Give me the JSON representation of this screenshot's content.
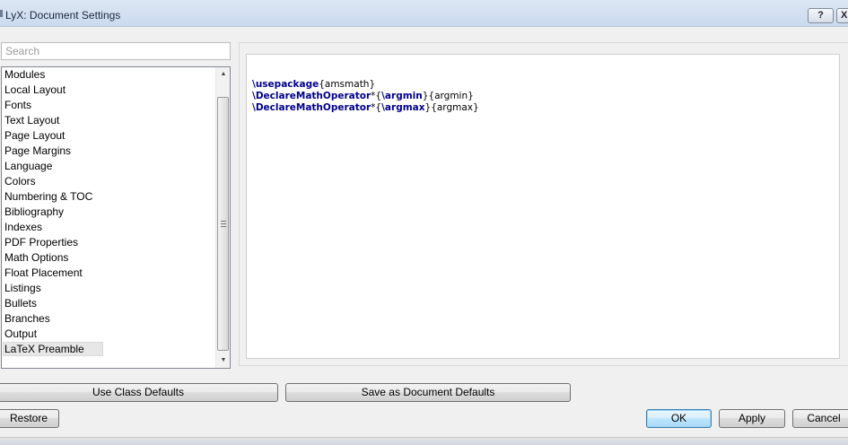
{
  "window": {
    "title": "LyX: Document Settings",
    "help_label": "?",
    "close_label": "X"
  },
  "search": {
    "placeholder": "Search",
    "value": ""
  },
  "categories": {
    "items": [
      "Modules",
      "Local Layout",
      "Fonts",
      "Text Layout",
      "Page Layout",
      "Page Margins",
      "Language",
      "Colors",
      "Numbering & TOC",
      "Bibliography",
      "Indexes",
      "PDF Properties",
      "Math Options",
      "Float Placement",
      "Listings",
      "Bullets",
      "Branches",
      "Output",
      "LaTeX Preamble"
    ],
    "selected": "LaTeX Preamble"
  },
  "preamble": {
    "lines": [
      {
        "cmd": "\\usepackage",
        "rest": "{amsmath}"
      },
      {
        "cmd": "\\DeclareMathOperator",
        "mid": "*{",
        "cmd2": "\\argmin",
        "rest": "}{argmin}"
      },
      {
        "cmd": "\\DeclareMathOperator",
        "mid": "*{",
        "cmd2": "\\argmax",
        "rest": "}{argmax}"
      }
    ]
  },
  "buttons": {
    "use_class_defaults": "Use Class Defaults",
    "save_as_document_defaults": "Save as Document Defaults",
    "restore": "Restore",
    "ok": "OK",
    "apply": "Apply",
    "cancel": "Cancel"
  },
  "icons": {
    "scroll_up": "up-arrow-icon",
    "scroll_down": "down-arrow-icon",
    "scroll_grip": "grip-icon"
  }
}
